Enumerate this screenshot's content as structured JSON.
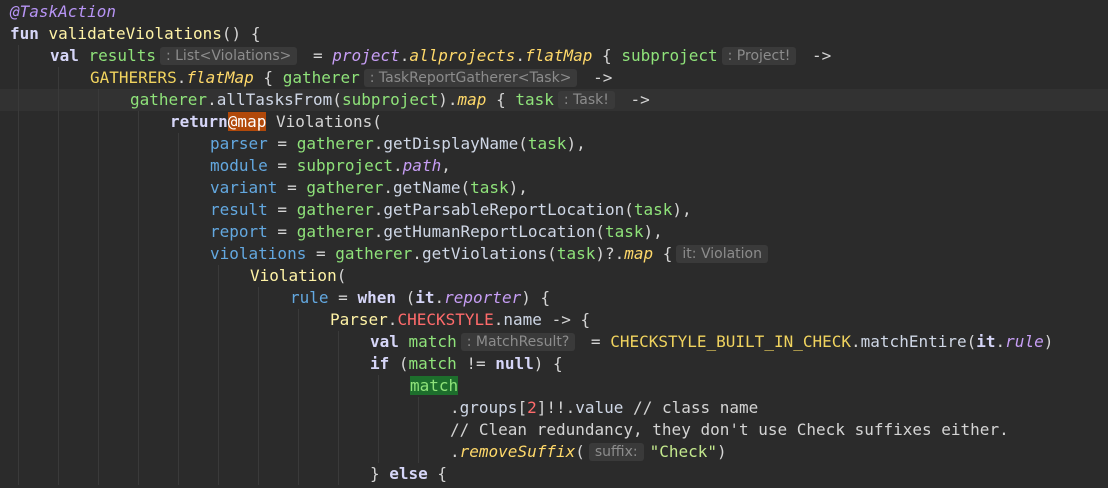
{
  "editor": {
    "lines": [
      {
        "indent": 0,
        "segments": [
          {
            "t": "ann",
            "v": "@TaskAction"
          }
        ]
      },
      {
        "indent": 0,
        "segments": [
          {
            "t": "kw",
            "v": "fun "
          },
          {
            "t": "fn",
            "v": "validateViolations"
          },
          {
            "t": "plain",
            "v": "() {"
          }
        ]
      },
      {
        "indent": 1,
        "segments": [
          {
            "t": "kw",
            "v": "val "
          },
          {
            "t": "param",
            "v": "results"
          },
          {
            "t": "hint",
            "v": ": List<Violations>"
          },
          {
            "t": "plain",
            "v": " = "
          },
          {
            "t": "it-prop",
            "v": "project"
          },
          {
            "t": "plain",
            "v": "."
          },
          {
            "t": "it-fn",
            "v": "allprojects"
          },
          {
            "t": "plain",
            "v": "."
          },
          {
            "t": "it-fn",
            "v": "flatMap"
          },
          {
            "t": "plain",
            "v": " { "
          },
          {
            "t": "param",
            "v": "subproject"
          },
          {
            "t": "hint",
            "v": ": Project!"
          },
          {
            "t": "plain",
            "v": " ->"
          }
        ]
      },
      {
        "indent": 2,
        "segments": [
          {
            "t": "const",
            "v": "GATHERERS"
          },
          {
            "t": "plain",
            "v": "."
          },
          {
            "t": "it-fn",
            "v": "flatMap"
          },
          {
            "t": "plain",
            "v": " { "
          },
          {
            "t": "param",
            "v": "gatherer"
          },
          {
            "t": "hint",
            "v": ": TaskReportGatherer<Task>"
          },
          {
            "t": "plain",
            "v": " ->"
          }
        ]
      },
      {
        "indent": 3,
        "current": true,
        "segments": [
          {
            "t": "param",
            "v": "gatherer"
          },
          {
            "t": "plain",
            "v": "."
          },
          {
            "t": "ident",
            "v": "allTasksFrom"
          },
          {
            "t": "plain",
            "v": "("
          },
          {
            "t": "param",
            "v": "subproject"
          },
          {
            "t": "plain",
            "v": ")."
          },
          {
            "t": "it-fn",
            "v": "map"
          },
          {
            "t": "plain",
            "v": " { "
          },
          {
            "t": "param",
            "v": "task"
          },
          {
            "t": "hint",
            "v": ": Task!"
          },
          {
            "t": "plain",
            "v": " ->"
          }
        ]
      },
      {
        "indent": 4,
        "segments": [
          {
            "t": "kw",
            "v": "return"
          },
          {
            "t": "label",
            "v": "@map"
          },
          {
            "t": "plain",
            "v": " Violations("
          }
        ]
      },
      {
        "indent": 5,
        "segments": [
          {
            "t": "prop",
            "v": "parser"
          },
          {
            "t": "plain",
            "v": " = "
          },
          {
            "t": "param",
            "v": "gatherer"
          },
          {
            "t": "plain",
            "v": "."
          },
          {
            "t": "ident",
            "v": "getDisplayName"
          },
          {
            "t": "plain",
            "v": "("
          },
          {
            "t": "param",
            "v": "task"
          },
          {
            "t": "plain",
            "v": "),"
          }
        ]
      },
      {
        "indent": 5,
        "segments": [
          {
            "t": "prop",
            "v": "module"
          },
          {
            "t": "plain",
            "v": " = "
          },
          {
            "t": "param",
            "v": "subproject"
          },
          {
            "t": "plain",
            "v": "."
          },
          {
            "t": "it-prop",
            "v": "path"
          },
          {
            "t": "plain",
            "v": ","
          }
        ]
      },
      {
        "indent": 5,
        "segments": [
          {
            "t": "prop",
            "v": "variant"
          },
          {
            "t": "plain",
            "v": " = "
          },
          {
            "t": "param",
            "v": "gatherer"
          },
          {
            "t": "plain",
            "v": "."
          },
          {
            "t": "ident",
            "v": "getName"
          },
          {
            "t": "plain",
            "v": "("
          },
          {
            "t": "param",
            "v": "task"
          },
          {
            "t": "plain",
            "v": "),"
          }
        ]
      },
      {
        "indent": 5,
        "segments": [
          {
            "t": "prop",
            "v": "result"
          },
          {
            "t": "plain",
            "v": " = "
          },
          {
            "t": "param",
            "v": "gatherer"
          },
          {
            "t": "plain",
            "v": "."
          },
          {
            "t": "ident",
            "v": "getParsableReportLocation"
          },
          {
            "t": "plain",
            "v": "("
          },
          {
            "t": "param",
            "v": "task"
          },
          {
            "t": "plain",
            "v": "),"
          }
        ]
      },
      {
        "indent": 5,
        "segments": [
          {
            "t": "prop",
            "v": "report"
          },
          {
            "t": "plain",
            "v": " = "
          },
          {
            "t": "param",
            "v": "gatherer"
          },
          {
            "t": "plain",
            "v": "."
          },
          {
            "t": "ident",
            "v": "getHumanReportLocation"
          },
          {
            "t": "plain",
            "v": "("
          },
          {
            "t": "param",
            "v": "task"
          },
          {
            "t": "plain",
            "v": "),"
          }
        ]
      },
      {
        "indent": 5,
        "segments": [
          {
            "t": "prop",
            "v": "violations"
          },
          {
            "t": "plain",
            "v": " = "
          },
          {
            "t": "param",
            "v": "gatherer"
          },
          {
            "t": "plain",
            "v": "."
          },
          {
            "t": "ident",
            "v": "getViolations"
          },
          {
            "t": "plain",
            "v": "("
          },
          {
            "t": "param",
            "v": "task"
          },
          {
            "t": "plain",
            "v": ")?."
          },
          {
            "t": "it-fn",
            "v": "map"
          },
          {
            "t": "plain",
            "v": " {"
          },
          {
            "t": "hint",
            "v": "it: Violation"
          }
        ]
      },
      {
        "indent": 6,
        "segments": [
          {
            "t": "fn",
            "v": "Violation"
          },
          {
            "t": "plain",
            "v": "("
          }
        ]
      },
      {
        "indent": 7,
        "segments": [
          {
            "t": "prop",
            "v": "rule"
          },
          {
            "t": "plain",
            "v": " = "
          },
          {
            "t": "kw",
            "v": "when"
          },
          {
            "t": "plain",
            "v": " ("
          },
          {
            "t": "kw",
            "v": "it"
          },
          {
            "t": "plain",
            "v": "."
          },
          {
            "t": "it-prop",
            "v": "reporter"
          },
          {
            "t": "plain",
            "v": ") {"
          }
        ]
      },
      {
        "indent": 8,
        "segments": [
          {
            "t": "fn",
            "v": "Parser"
          },
          {
            "t": "plain",
            "v": "."
          },
          {
            "t": "const-red",
            "v": "CHECKSTYLE"
          },
          {
            "t": "plain",
            "v": "."
          },
          {
            "t": "ident",
            "v": "name"
          },
          {
            "t": "plain",
            "v": " -> {"
          }
        ]
      },
      {
        "indent": 9,
        "segments": [
          {
            "t": "kw",
            "v": "val "
          },
          {
            "t": "param",
            "v": "match"
          },
          {
            "t": "hint",
            "v": ": MatchResult?"
          },
          {
            "t": "plain",
            "v": " = "
          },
          {
            "t": "const",
            "v": "CHECKSTYLE_BUILT_IN_CHECK"
          },
          {
            "t": "plain",
            "v": "."
          },
          {
            "t": "ident",
            "v": "matchEntire"
          },
          {
            "t": "plain",
            "v": "("
          },
          {
            "t": "kw",
            "v": "it"
          },
          {
            "t": "plain",
            "v": "."
          },
          {
            "t": "it-prop",
            "v": "rule"
          },
          {
            "t": "plain",
            "v": ")"
          }
        ]
      },
      {
        "indent": 9,
        "segments": [
          {
            "t": "kw",
            "v": "if"
          },
          {
            "t": "plain",
            "v": " ("
          },
          {
            "t": "param",
            "v": "match"
          },
          {
            "t": "plain",
            "v": " != "
          },
          {
            "t": "kw",
            "v": "null"
          },
          {
            "t": "plain",
            "v": ") {"
          }
        ]
      },
      {
        "indent": 10,
        "segments": [
          {
            "t": "param-hl",
            "v": "match"
          }
        ]
      },
      {
        "indent": 11,
        "segments": [
          {
            "t": "plain",
            "v": "."
          },
          {
            "t": "ident",
            "v": "groups"
          },
          {
            "t": "plain",
            "v": "["
          },
          {
            "t": "num",
            "v": "2"
          },
          {
            "t": "plain",
            "v": "]!!."
          },
          {
            "t": "ident",
            "v": "value"
          },
          {
            "t": "cmt",
            "v": " // class name"
          }
        ]
      },
      {
        "indent": 11,
        "segments": [
          {
            "t": "cmt",
            "v": "// Clean redundancy, they don't use Check suffixes either."
          }
        ]
      },
      {
        "indent": 11,
        "segments": [
          {
            "t": "plain",
            "v": "."
          },
          {
            "t": "it-fn",
            "v": "removeSuffix"
          },
          {
            "t": "plain",
            "v": "("
          },
          {
            "t": "hint",
            "v": "suffix:"
          },
          {
            "t": "str",
            "v": "\"Check\""
          },
          {
            "t": "plain",
            "v": ")"
          }
        ]
      },
      {
        "indent": 9,
        "segments": [
          {
            "t": "plain",
            "v": "} "
          },
          {
            "t": "kw",
            "v": "else"
          },
          {
            "t": "plain",
            "v": " {"
          }
        ]
      }
    ]
  }
}
